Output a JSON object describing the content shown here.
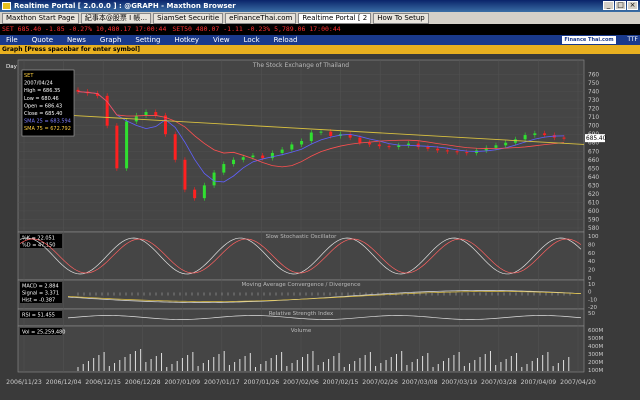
{
  "window": {
    "title": "Realtime Portal [ 2.0.0.0 ] : @GRAPH - Maxthon Browser"
  },
  "tabs": [
    {
      "label": "Maxthon Start Page"
    },
    {
      "label": "紀事本@股票 I 帳..."
    },
    {
      "label": "SiamSet Securitie"
    },
    {
      "label": "eFinanceThai.com"
    },
    {
      "label": "Realtime Portal [ 2"
    },
    {
      "label": "How To Setup"
    }
  ],
  "ticker": [
    {
      "text": "SET 685.40 -1.85 -0.27% 10,480.17 17:00:44",
      "color": "#ff3030"
    },
    {
      "text": "SET50 480.07 -1.11 -0.23% 5,789.06 17:00:44",
      "color": "#ff3030"
    }
  ],
  "menu": [
    "File",
    "Quote",
    "News",
    "Graph",
    "Setting",
    "Hotkey",
    "View",
    "Lock",
    "Reload"
  ],
  "logo_text": "Finance Thai.com",
  "ttf_text": "TTF",
  "graph_bar": "Graph [Press spacebar for enter symbol]",
  "chart_data": [
    {
      "type": "candlestick",
      "title": "The Stock Exchange of Thailand",
      "period_label": "Day",
      "ylim": [
        580,
        770
      ],
      "y_ticks": [
        760,
        750,
        740,
        730,
        720,
        710,
        700,
        690,
        680,
        670,
        660,
        650,
        640,
        630,
        620,
        610,
        600,
        590,
        580
      ],
      "last_price_label": "685.40",
      "info_box": [
        "SET",
        "2007/04/24",
        "High = 686.35",
        "Low = 680.46",
        "Open = 686.43",
        "Close = 685.40",
        "SMA 25 = 683.594",
        "SMA 75 = 672.792"
      ],
      "x_labels": [
        "2006/11/23",
        "2006/12/04",
        "2006/12/15",
        "2006/12/28",
        "2007/01/09",
        "2007/01/17",
        "2007/01/26",
        "2007/02/06",
        "2007/02/15",
        "2007/02/26",
        "2007/03/08",
        "2007/03/19",
        "2007/03/28",
        "2007/04/09",
        "2007/04/20"
      ],
      "close": [
        740,
        738,
        735,
        700,
        650,
        705,
        712,
        716,
        712,
        690,
        660,
        625,
        615,
        630,
        645,
        655,
        660,
        663,
        665,
        662,
        668,
        672,
        678,
        682,
        692,
        693,
        688,
        690,
        686,
        680,
        678,
        676,
        675,
        677,
        679,
        675,
        673,
        671,
        670,
        669,
        668,
        671,
        674,
        677,
        680,
        684,
        689,
        691,
        689,
        686,
        685.4
      ],
      "series": [
        {
          "name": "SMA 25",
          "color": "#6060ff"
        },
        {
          "name": "SMA 75",
          "color": "#ff5050"
        },
        {
          "name": "Trend",
          "color": "#d8c040"
        }
      ]
    },
    {
      "type": "line",
      "title": "Slow Stochastic Oscillator",
      "labels": [
        "%K = 22.051",
        "%D = 47.150"
      ],
      "y_ticks": [
        100,
        80,
        60,
        40,
        20,
        0
      ]
    },
    {
      "type": "line",
      "title": "Moving Average Convergence / Divergence",
      "labels": [
        "MACD = 2.884",
        "Signal = 3.371",
        "Hist = -0.387"
      ],
      "y_ticks": [
        10,
        0,
        -10,
        -20
      ]
    },
    {
      "type": "line",
      "title": "Relative Strength Index",
      "labels": [
        "RSI = 51.455"
      ],
      "y_ticks": [
        50
      ]
    },
    {
      "type": "bar",
      "title": "Volume",
      "labels": [
        "Vol = 25,259,480"
      ],
      "y_ticks": [
        "600M",
        "500M",
        "400M",
        "300M",
        "200M",
        "100M"
      ]
    }
  ]
}
